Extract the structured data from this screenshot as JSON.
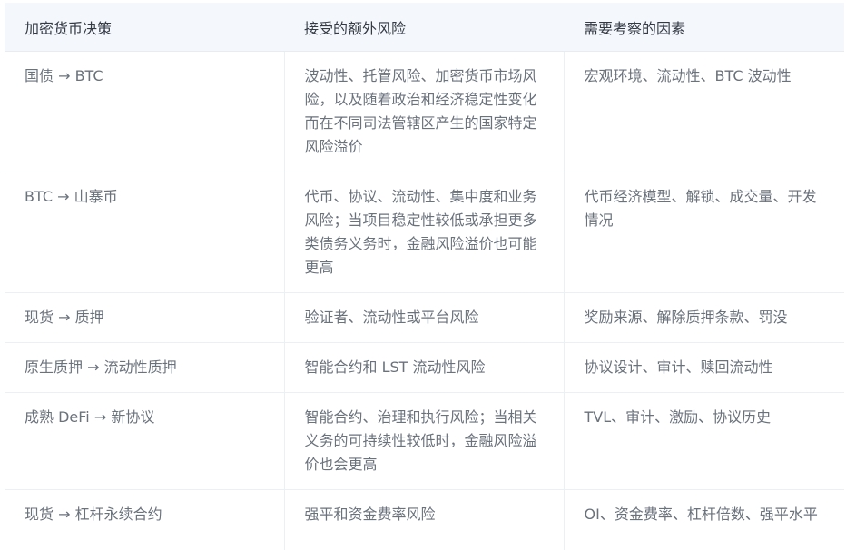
{
  "table": {
    "headers": [
      "加密货币决策",
      "接受的额外风险",
      "需要考察的因素"
    ],
    "rows": [
      [
        "国债 → BTC",
        "波动性、托管风险、加密货币市场风险，以及随着政治和经济稳定性变化而在不同司法管辖区产生的国家特定风险溢价",
        "宏观环境、流动性、BTC 波动性"
      ],
      [
        "BTC → 山寨币",
        "代币、协议、流动性、集中度和业务风险；当项目稳定性较低或承担更多类债务义务时，金融风险溢价也可能更高",
        "代币经济模型、解锁、成交量、开发情况"
      ],
      [
        "现货 → 质押",
        "验证者、流动性或平台风险",
        "奖励来源、解除质押条款、罚没"
      ],
      [
        "原生质押 → 流动性质押",
        "智能合约和 LST 流动性风险",
        "协议设计、审计、赎回流动性"
      ],
      [
        "成熟 DeFi → 新协议",
        "智能合约、治理和执行风险；当相关义务的可持续性较低时，金融风险溢价也会更高",
        "TVL、审计、激励、协议历史"
      ],
      [
        "现货 → 杠杆永续合约",
        "强平和资金费率风险",
        "OI、资金费率、杠杆倍数、强平水平"
      ]
    ]
  }
}
